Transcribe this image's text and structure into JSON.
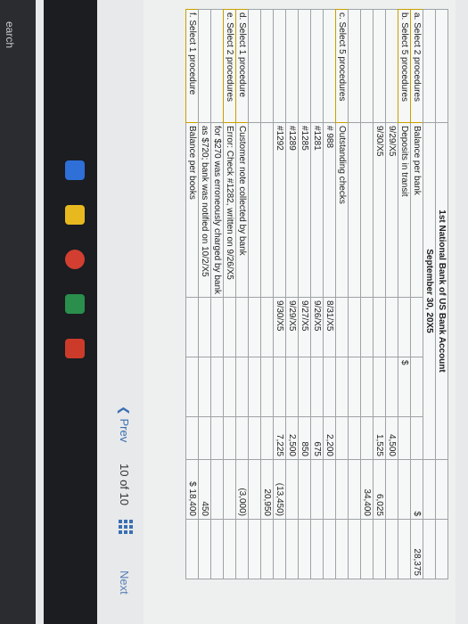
{
  "taskbar": {
    "search_label": "earch"
  },
  "sheet": {
    "header_title": "1st National Bank of US Bank Account",
    "header_date": "September 30, 20X5",
    "rows": [
      {
        "a": "a. Select 2 procedures",
        "b": "Balance per bank",
        "c": "",
        "d": "",
        "e": "",
        "f": "$",
        "g": "28,375"
      },
      {
        "a": "b. Select 5 procedures",
        "b": "Deposits in transit",
        "c": "",
        "d": "$",
        "e": "",
        "f": "",
        "g": ""
      },
      {
        "a": "",
        "b": "9/29/X5",
        "c": "",
        "d": "",
        "e": "4,500",
        "f": "",
        "g": ""
      },
      {
        "a": "",
        "b": "9/30/X5",
        "c": "",
        "d": "",
        "e": "1,525",
        "f": "6,025",
        "g": ""
      },
      {
        "a": "",
        "b": "",
        "c": "",
        "d": "",
        "e": "",
        "f": "34,400",
        "g": ""
      },
      {
        "a": "",
        "b": "",
        "c": "",
        "d": "",
        "e": "",
        "f": "",
        "g": ""
      },
      {
        "a": "c. Select 5 procedures",
        "b": "Outstanding checks",
        "c": "",
        "d": "",
        "e": "",
        "f": "",
        "g": ""
      },
      {
        "a": "",
        "b": "# 988",
        "c": "8/31/X5",
        "d": "",
        "e": "2,200",
        "f": "",
        "g": ""
      },
      {
        "a": "",
        "b": "#1281",
        "c": "9/26/X5",
        "d": "",
        "e": "675",
        "f": "",
        "g": ""
      },
      {
        "a": "",
        "b": "#1285",
        "c": "9/27/X5",
        "d": "",
        "e": "850",
        "f": "",
        "g": ""
      },
      {
        "a": "",
        "b": "#1289",
        "c": "9/29/X5",
        "d": "",
        "e": "2,500",
        "f": "",
        "g": ""
      },
      {
        "a": "",
        "b": "#1292",
        "c": "9/30/X5",
        "d": "",
        "e": "7,225",
        "f": "(13,450)",
        "g": ""
      },
      {
        "a": "",
        "b": "",
        "c": "",
        "d": "",
        "e": "",
        "f": "20,950",
        "g": ""
      },
      {
        "a": "",
        "b": "",
        "c": "",
        "d": "",
        "e": "",
        "f": "",
        "g": ""
      },
      {
        "a": "d. Select 1 procedure",
        "b": "Customer note collected by bank",
        "c": "",
        "d": "",
        "e": "",
        "f": "(3,000)",
        "g": ""
      },
      {
        "a": "e. Select 2 procedures",
        "b": "Error: Check #1282, written on 9/26/X5",
        "c": "",
        "d": "",
        "e": "",
        "f": "",
        "g": ""
      },
      {
        "a": "",
        "b": "for $270 was erroneously charged by bank",
        "c": "",
        "d": "",
        "e": "",
        "f": "",
        "g": ""
      },
      {
        "a": "",
        "b": "as $720; bank was notified on 10/2/X5",
        "c": "",
        "d": "",
        "e": "",
        "f": "450",
        "g": ""
      },
      {
        "a": "f. Select 1 procedure",
        "b": "Balance per books",
        "c": "",
        "d": "",
        "e": "",
        "f": "$ 18,400",
        "g": ""
      }
    ]
  },
  "nav": {
    "prev_label": "Prev",
    "page_current": "10",
    "page_of": "of",
    "page_total": "10",
    "next_label": "Next"
  },
  "colors": {
    "accent": "#3a6fb3",
    "caret": "#d08000",
    "grid": "#9ea3a6"
  }
}
